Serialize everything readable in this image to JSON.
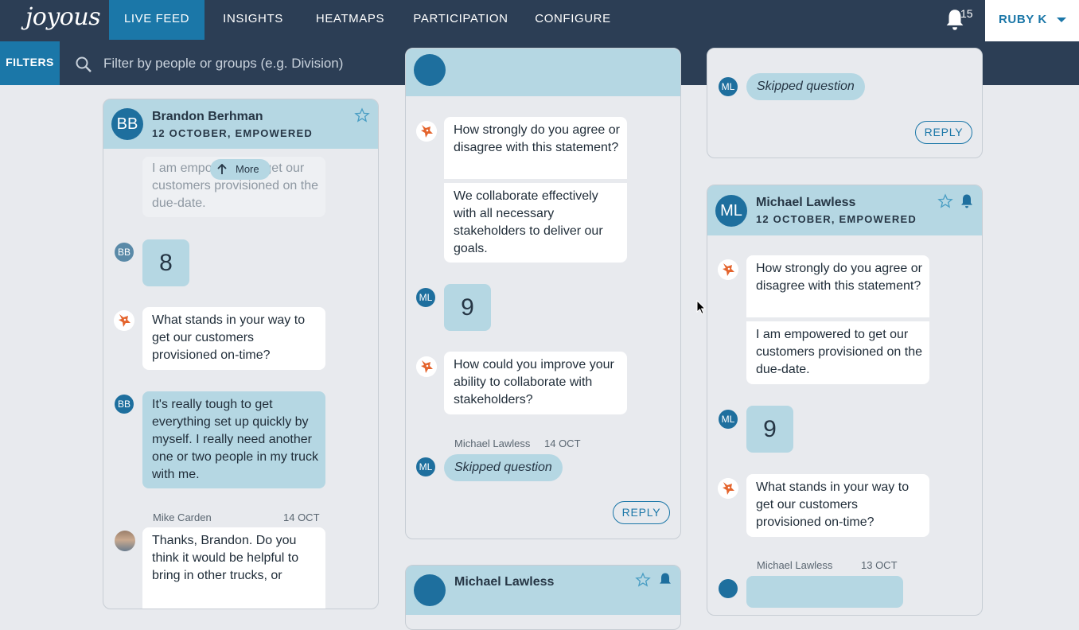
{
  "app": {
    "logo": "joyous"
  },
  "nav": [
    {
      "label": "LIVE FEED",
      "active": true
    },
    {
      "label": "INSIGHTS",
      "active": false
    },
    {
      "label": "HEATMAPS",
      "active": false
    },
    {
      "label": "PARTICIPATION",
      "active": false
    },
    {
      "label": "CONFIGURE",
      "active": false
    }
  ],
  "notifications": {
    "count": "15"
  },
  "user": {
    "name": "RUBY K"
  },
  "filterbar": {
    "button_label": "FILTERS",
    "placeholder": "Filter by people or groups (e.g. Division)"
  },
  "colors": {
    "navy": "#2c3e55",
    "accent": "#1b77a8",
    "bubble_blue": "#b5d7e3",
    "avatar": "#1e6f9e",
    "background": "#e8eaee"
  },
  "col1": {
    "author": "Brandon Berhman",
    "initials": "BB",
    "subtitle": "12 OCTOBER, EMPOWERED",
    "faded_text": "I am empowered to get our customers provisioned on the due-date.",
    "more_label": "More",
    "rating": "8",
    "question": "What stands in your way to get our customers provisioned on-time?",
    "answer": "It's really tough to get everything set up quickly by myself. I really need another one or two people in my truck with me.",
    "reply_author": "Mike Carden",
    "reply_date": "14 OCT",
    "reply_text": "Thanks, Brandon. Do you think it would be helpful to bring in other trucks, or"
  },
  "col2": {
    "question1": "How strongly do you agree or disagree with this statement?",
    "statement": "We collaborate effectively with all necessary stakeholders to deliver our goals.",
    "rating_initials": "ML",
    "rating": "9",
    "question2": "How could you improve your ability to collaborate with stakeholders?",
    "skip_author": "Michael Lawless",
    "skip_date": "14 OCT",
    "skip_initials": "ML",
    "skip_text": "Skipped question",
    "reply_label": "REPLY",
    "next_author": "Michael Lawless"
  },
  "col3": {
    "top_initials": "ML",
    "top_skip": "Skipped question",
    "reply_label": "REPLY",
    "author": "Michael Lawless",
    "initials": "ML",
    "subtitle": "12 OCTOBER, EMPOWERED",
    "question1": "How strongly do you agree or disagree with this statement?",
    "statement": "I am empowered to get our customers provisioned on the due-date.",
    "rating_initials": "ML",
    "rating": "9",
    "question2": "What stands in your way to get our customers provisioned on-time?",
    "meta_author": "Michael Lawless",
    "meta_date": "13 OCT"
  }
}
